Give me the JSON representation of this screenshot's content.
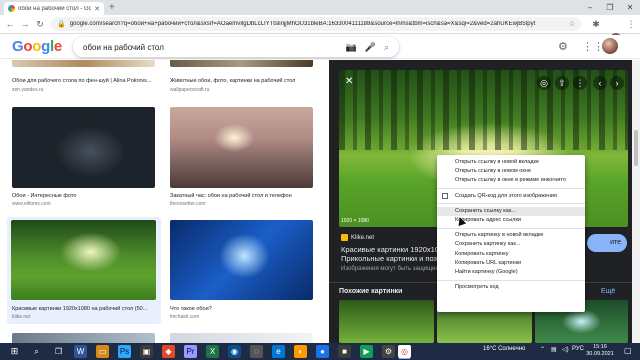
{
  "browser": {
    "tab_title": "обои на рабочий стол - Googl",
    "url": "google.com/search?q=обои+на+рабочий+стол&sxsrf=AOaemvIlgDbLcLIYTtslinjjMhOU31bleBA:1633004111188&source=lnms&tbm=isch&sa=X&sqi=2&ved=2ahUKEwjB5tpyt"
  },
  "google": {
    "logo_letters": [
      "G",
      "o",
      "o",
      "g",
      "l",
      "e"
    ],
    "logo_colors": [
      "#4285f4",
      "#ea4335",
      "#fbbc05",
      "#4285f4",
      "#34a853",
      "#ea4335"
    ],
    "query": "обои на рабочий стол"
  },
  "results": [
    {
      "caption": "Обои для рабочего стола по фен-шуй | Alina Pokrovs...",
      "source": "zen.yandex.ru"
    },
    {
      "caption": "Животные обои, фото, картинки на рабочий стол",
      "source": "wallpaperscraft.ru"
    },
    {
      "caption": "Обои - Интересные фото",
      "source": "www.elitoms.com"
    },
    {
      "caption": "Закатный час: обои на рабочий стол и телефон",
      "source": "theoosetter.com"
    },
    {
      "caption": "Красивые картинки 1920х1080 на рабочий стол (50...",
      "source": "klike.net"
    },
    {
      "caption": "Что такое обои?",
      "source": "lmchakit.com"
    }
  ],
  "panel": {
    "dims": "1920 × 1080",
    "site": "Klike.net",
    "title": "Красивые картинки 1920х1080 на рабочий стол (50 фото) — Прикольные картинки и позитив",
    "title_visible": "Красивые картинки 1920х1080 Прикольные картинки и позит",
    "note": "Изображения могут быть защищен",
    "visit": "ите",
    "similar": "Похожие картинки",
    "see_all": "Ещё"
  },
  "context_menu": {
    "group1": [
      "Открыть ссылку в новой вкладке",
      "Открыть ссылку в новом окне",
      "Открыть ссылку в окне в режиме инкогнито"
    ],
    "qr": "Создать QR-код для этого изображения",
    "group2": [
      "Сохранить ссылку как...",
      "Копировать адрес ссылки"
    ],
    "group3": [
      "Открыть картинку в новой вкладке",
      "Сохранить картинку как...",
      "Копировать картинку",
      "Копировать URL картинки",
      "Найти картинку (Google)"
    ],
    "inspect": "Просмотреть код"
  },
  "taskbar": {
    "weather": "16°C  Солнечно",
    "lang": "РУС",
    "time": "15:16",
    "date": "30.09.2021"
  }
}
